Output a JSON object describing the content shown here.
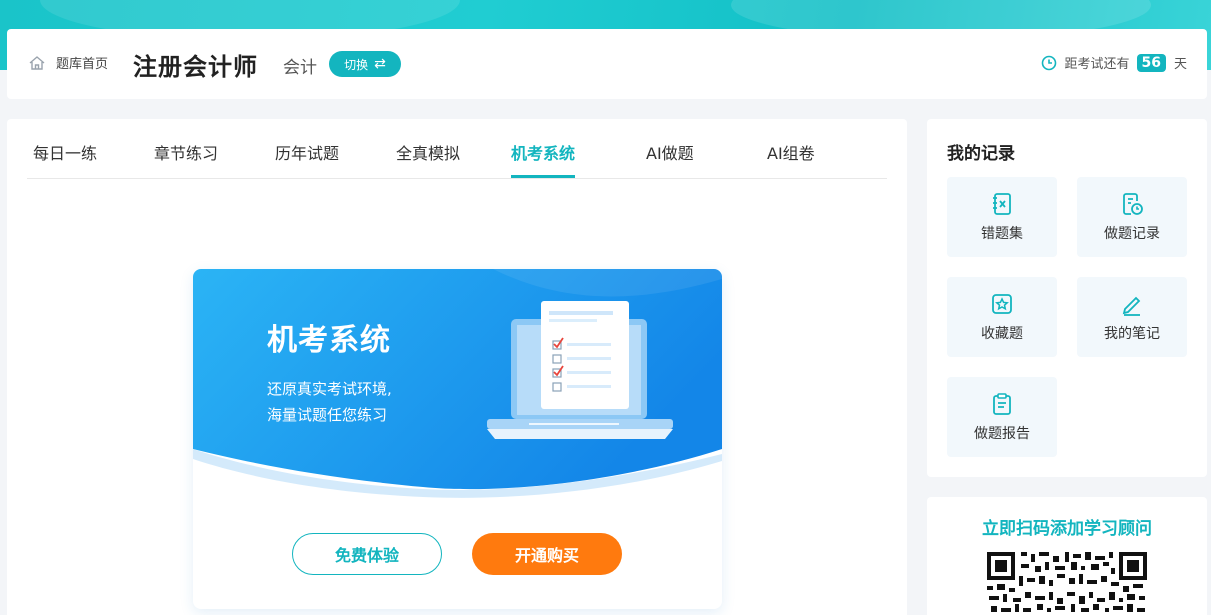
{
  "header": {
    "home_label": "题库首页",
    "title": "注册会计师",
    "subject": "会计",
    "switch_label": "切换",
    "countdown_prefix": "距考试还有",
    "days": "56",
    "countdown_suffix": "天"
  },
  "tabs": [
    {
      "label": "每日一练",
      "active": false
    },
    {
      "label": "章节练习",
      "active": false
    },
    {
      "label": "历年试题",
      "active": false
    },
    {
      "label": "全真模拟",
      "active": false
    },
    {
      "label": "机考系统",
      "active": true
    },
    {
      "label": "AI做题",
      "active": false
    },
    {
      "label": "AI组卷",
      "active": false
    }
  ],
  "promo": {
    "title": "机考系统",
    "desc_line1": "还原真实考试环境,",
    "desc_line2": "海量试题任您练习",
    "trial_label": "免费体验",
    "buy_label": "开通购买"
  },
  "records": {
    "title": "我的记录",
    "items": [
      {
        "label": "错题集",
        "icon": "wrong-book-icon"
      },
      {
        "label": "做题记录",
        "icon": "history-icon"
      },
      {
        "label": "收藏题",
        "icon": "star-icon"
      },
      {
        "label": "我的笔记",
        "icon": "pen-icon"
      },
      {
        "label": "做题报告",
        "icon": "report-icon"
      }
    ]
  },
  "advisor": {
    "title": "立即扫码添加学习顾问"
  },
  "colors": {
    "accent": "#13b5bf",
    "buy": "#ff7a0e",
    "promo_blue": "#1a9cf0"
  }
}
